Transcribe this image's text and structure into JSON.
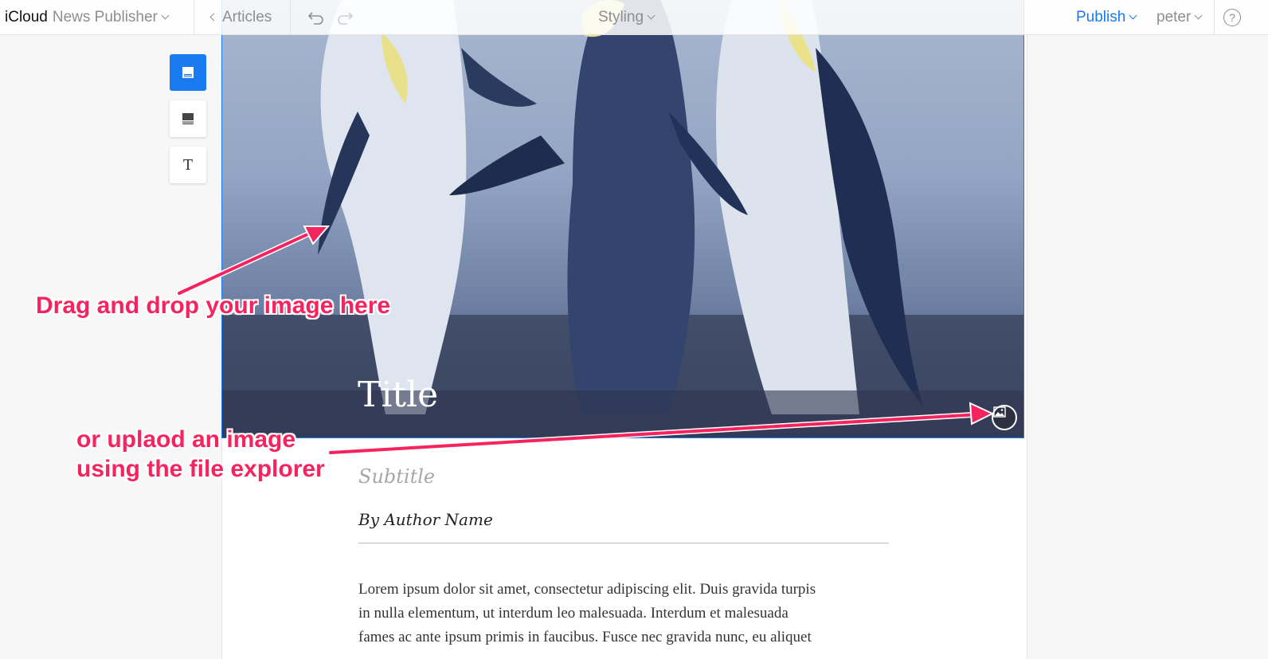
{
  "topbar": {
    "brand": "iCloud",
    "app_name": "News Publisher",
    "back_label": "Articles",
    "styling_label": "Styling",
    "publish_label": "Publish",
    "user_label": "peter",
    "help_label": "?"
  },
  "tools": [
    {
      "name": "header-layout-icon",
      "active": true
    },
    {
      "name": "image-block-icon",
      "active": false
    },
    {
      "name": "text-block-icon",
      "label": "T",
      "active": false
    }
  ],
  "article": {
    "title": "Title",
    "subtitle": "Subtitle",
    "byline": "By Author Name",
    "body_lines": [
      "Lorem ipsum dolor sit amet, consectetur adipiscing elit. Duis gravida turpis",
      "in nulla elementum, ut interdum leo malesuada. Interdum et malesuada",
      "fames ac ante ipsum primis in faucibus. Fusce nec gravida nunc, eu aliquet"
    ]
  },
  "annotations": {
    "drag_drop": "Drag and drop your image here",
    "upload_line1": "or uplaod an image",
    "upload_line2": "using the file explorer"
  },
  "colors": {
    "accent": "#1a7af0",
    "annotation": "#f5245e"
  }
}
